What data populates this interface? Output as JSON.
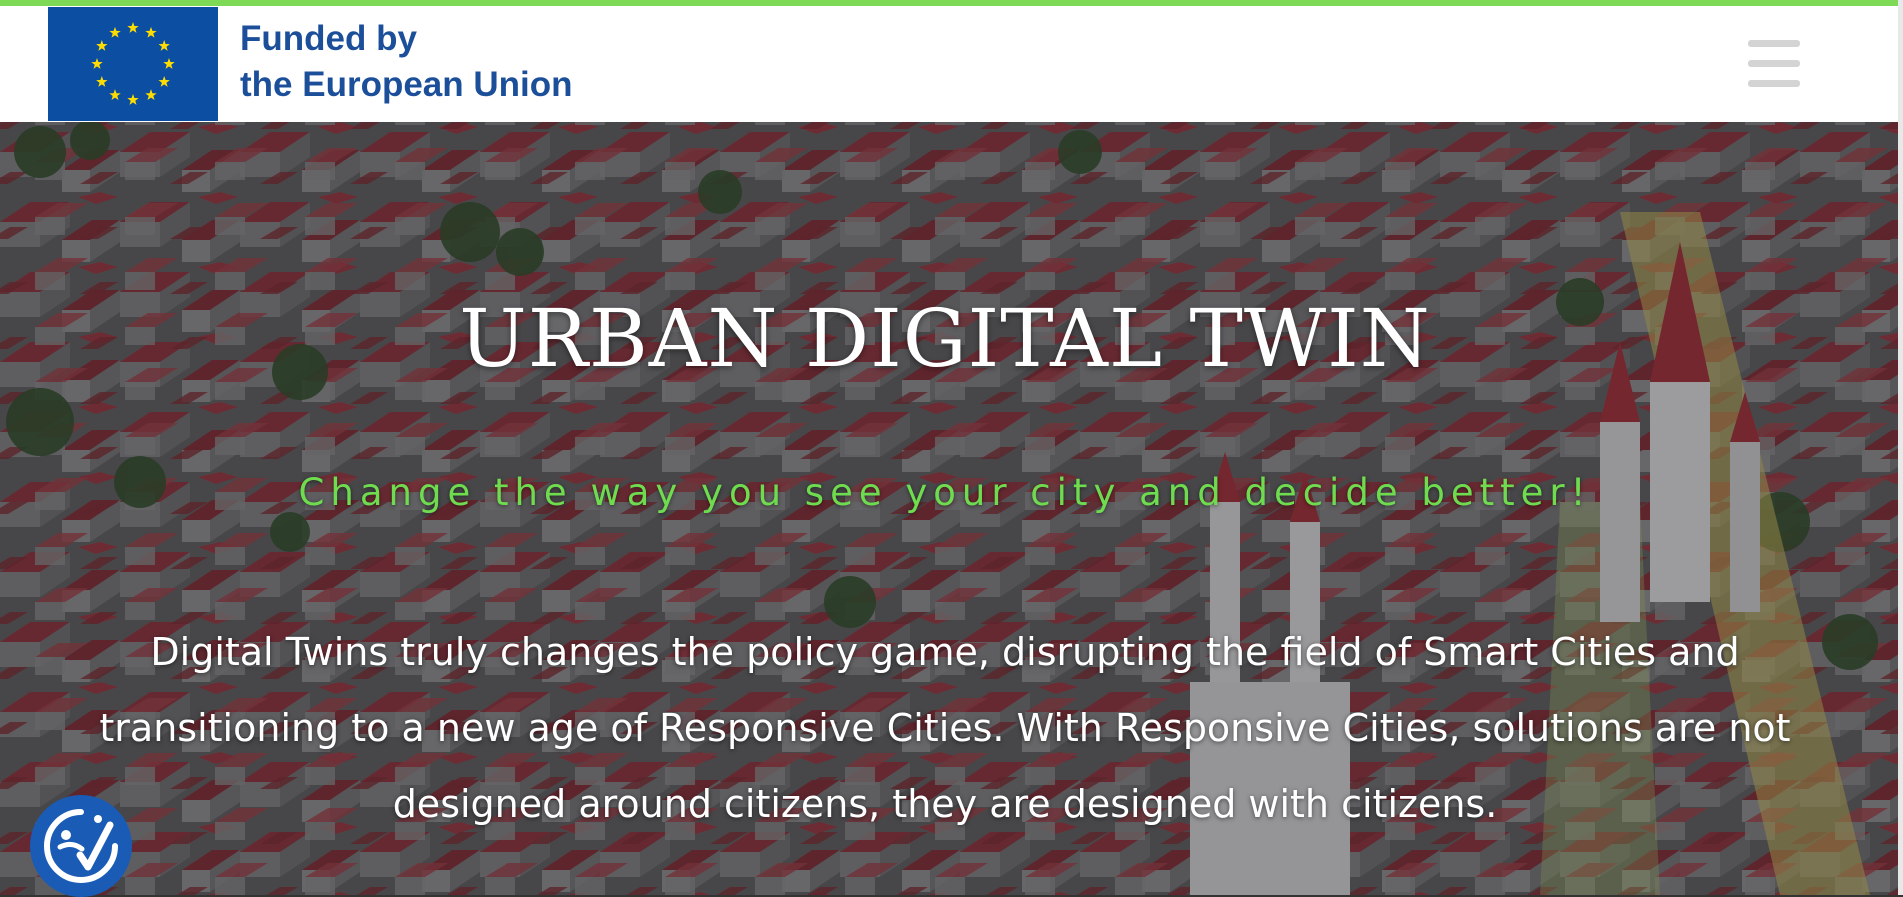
{
  "header": {
    "funded_line1": "Funded by",
    "funded_line2": "the European Union",
    "logo_icon": "eu-flag-icon",
    "menu_icon": "hamburger-menu-icon"
  },
  "hero": {
    "title": "URBAN DIGITAL TWIN",
    "tagline": "Change the way you see your city and decide better!",
    "body": "Digital Twins truly changes the policy game, disrupting the field of Smart Cities and transitioning to a new age of Responsive Cities. With Responsive Cities, solutions are not designed around citizens, they are designed with citizens."
  },
  "accessibility": {
    "icon": "accessibility-icon"
  },
  "colors": {
    "accent_green": "#7ed957",
    "tagline_green": "#6fdc4f",
    "eu_blue": "#1c4f9a",
    "eu_flag_blue": "#0b4ea2",
    "eu_star_yellow": "#ffdd00",
    "roof_red": "#8a2f3a",
    "a11y_blue": "#1a5bb5"
  }
}
